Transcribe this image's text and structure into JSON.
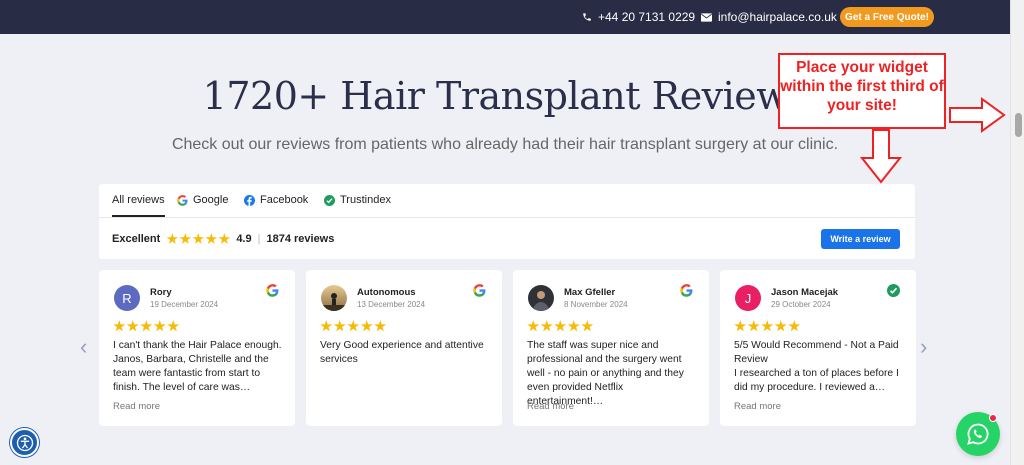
{
  "topbar": {
    "phone": "+44 20 7131 0229",
    "email": "info@hairpalace.co.uk",
    "quote_button": "Get a Free Quote!",
    "phone_icon": "phone-icon",
    "mail_icon": "envelope-icon"
  },
  "heading": {
    "title": "1720+ Hair Transplant Reviews",
    "subtitle": "Check out our reviews from patients who already had their hair transplant surgery at our clinic."
  },
  "annotation": {
    "text": "Place your widget within the first third of your site!",
    "color": "#ee2222"
  },
  "widget": {
    "tabs": [
      {
        "label": "All reviews",
        "icon": ""
      },
      {
        "label": "Google",
        "icon": "google-icon"
      },
      {
        "label": "Facebook",
        "icon": "facebook-icon"
      },
      {
        "label": "Trustindex",
        "icon": "trustindex-icon"
      }
    ],
    "summary": {
      "label": "Excellent",
      "stars": 5,
      "rating": "4.9",
      "separator": "|",
      "count": "1874 reviews"
    },
    "write_button": "Write a review",
    "accent": "#1a73e8"
  },
  "reviews": [
    {
      "initial": "R",
      "name": "Rory",
      "date": "19 December 2024",
      "source": "google",
      "stars": 5,
      "text": "I can't thank the Hair Palace enough. Janos, Barbara, Christelle and the team were fantastic from start to finish. The level of care was…",
      "more": "Read more",
      "avatar_color": "#5c6bc0"
    },
    {
      "initial": "",
      "name": "Autonomous",
      "date": "13 December 2024",
      "source": "google",
      "stars": 5,
      "text": "Very Good experience and attentive services",
      "more": "",
      "avatar_color": "#c9a66b"
    },
    {
      "initial": "",
      "name": "Max Gfeller",
      "date": "8 November 2024",
      "source": "google",
      "stars": 5,
      "text": "The staff was super nice and professional and the surgery went well - no pain or anything and they even provided Netflix entertainment!…",
      "more": "Read more",
      "avatar_color": "#3b3b3b"
    },
    {
      "initial": "J",
      "name": "Jason Macejak",
      "date": "29 October 2024",
      "source": "trustindex",
      "stars": 5,
      "text": "5/5 Would Recommend - Not a Paid Review\nI researched a ton of places before I did my procedure. I reviewed a…",
      "more": "Read more",
      "avatar_color": "#e91e63"
    }
  ],
  "nav": {
    "prev": "‹",
    "next": "›"
  },
  "colors": {
    "topbar": "#282c44",
    "quote": "#f29a1f",
    "star": "#f6bb06",
    "whatsapp": "#25d366"
  }
}
